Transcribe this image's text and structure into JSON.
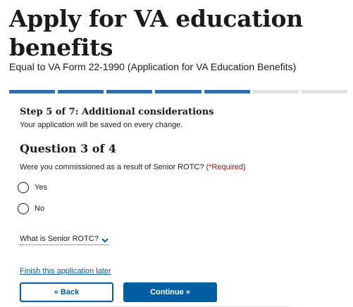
{
  "header": {
    "title": "Apply for VA education benefits",
    "subtitle": "Equal to VA Form 22-1990 (Application for VA Education Benefits)"
  },
  "progress": {
    "current_step": 5,
    "total_steps": 7,
    "segment_fraction_complete": 0.7142857,
    "complete_color": "#2e6bb0",
    "incomplete_color": "#dfe1e2"
  },
  "step": {
    "title": "Step 5 of 7: Additional considerations",
    "save_note": "Your application will be saved on every change."
  },
  "question": {
    "title": "Question 3 of 4",
    "text": "Were you commissioned as a result of Senior ROTC?",
    "required_label": "(*Required)",
    "options": [
      {
        "label": "Yes",
        "selected": false
      },
      {
        "label": "No",
        "selected": false
      }
    ]
  },
  "expander": {
    "label": "What is Senior ROTC?",
    "icon": "chevron-down-icon"
  },
  "links": {
    "finish_later": "Finish this application later"
  },
  "buttons": {
    "back": "« Back",
    "continue": "Continue »"
  },
  "colors": {
    "primary": "#005ea2",
    "required": "#b50909",
    "text": "#1b1b1b"
  }
}
